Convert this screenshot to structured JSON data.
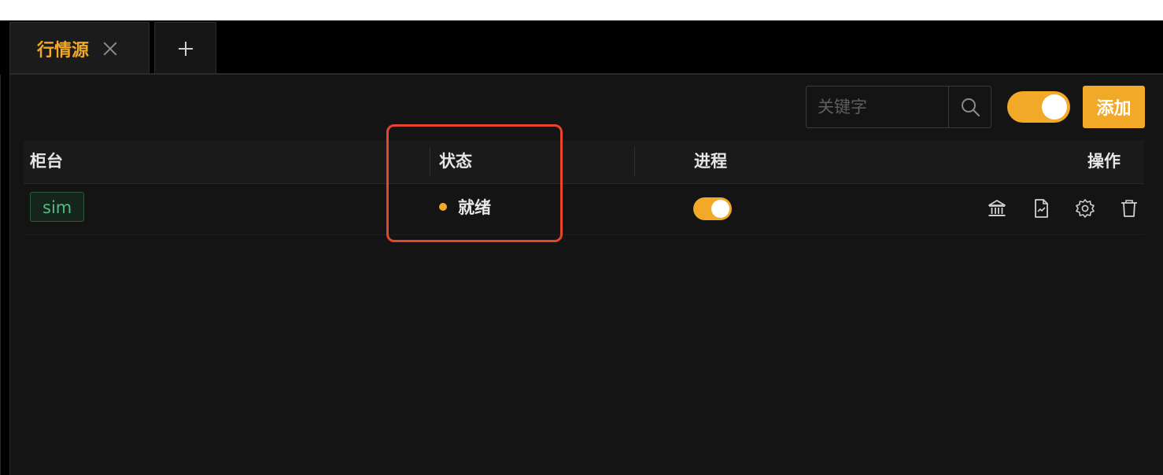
{
  "tabs": [
    {
      "label": "行情源",
      "active": true
    }
  ],
  "toolbar": {
    "search_placeholder": "关键字",
    "search_value": "",
    "toggle_on": true,
    "add_label": "添加"
  },
  "table": {
    "columns": [
      "柜台",
      "状态",
      "进程",
      "操作"
    ],
    "rows": [
      {
        "counter": "sim",
        "status": "就绪",
        "process_on": true
      }
    ]
  },
  "colors": {
    "accent": "#f3a928",
    "tag_green": "#58b883",
    "highlight": "#e8462c",
    "background": "#141414"
  },
  "icons": {
    "close": "close-icon",
    "add_tab": "plus-icon",
    "search": "search-icon",
    "actions": [
      "bank-icon",
      "document-icon",
      "gear-icon",
      "trash-icon"
    ]
  }
}
